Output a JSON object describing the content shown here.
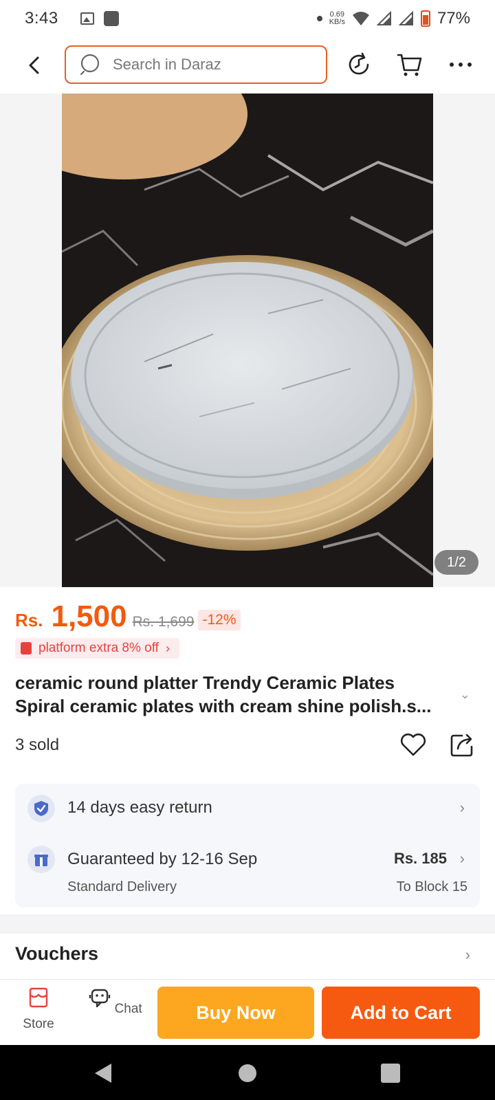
{
  "status_bar": {
    "time": "3:43",
    "net_speed_value": "0.69",
    "net_speed_unit": "KB/s",
    "battery": "77%"
  },
  "header": {
    "search_placeholder": "Search in Daraz"
  },
  "gallery": {
    "page_indicator": "1/2"
  },
  "product": {
    "currency": "Rs.",
    "price": "1,500",
    "original_price": "Rs. 1,699",
    "discount": "-12%",
    "promo": "platform extra 8% off",
    "title_line_1": "ceramic round platter Trendy Ceramic  Plates",
    "title_line_2": "Spiral ceramic plates with cream shine polish.s...",
    "sold": "3 sold"
  },
  "services": {
    "return_text": "14 days easy return",
    "delivery_text": "Guaranteed by 12-16 Sep",
    "delivery_type": "Standard Delivery",
    "delivery_fee": "Rs. 185",
    "delivery_dest": "To Block 15"
  },
  "vouchers": {
    "label": "Vouchers"
  },
  "action_bar": {
    "store_label": "Store",
    "chat_label": "Chat",
    "buy_now_label": "Buy Now",
    "add_to_cart_label": "Add to Cart"
  },
  "colors": {
    "accent_orange": "#f65a10",
    "buy_now_yellow": "#fca71f",
    "price_orange": "#f25a0f"
  }
}
